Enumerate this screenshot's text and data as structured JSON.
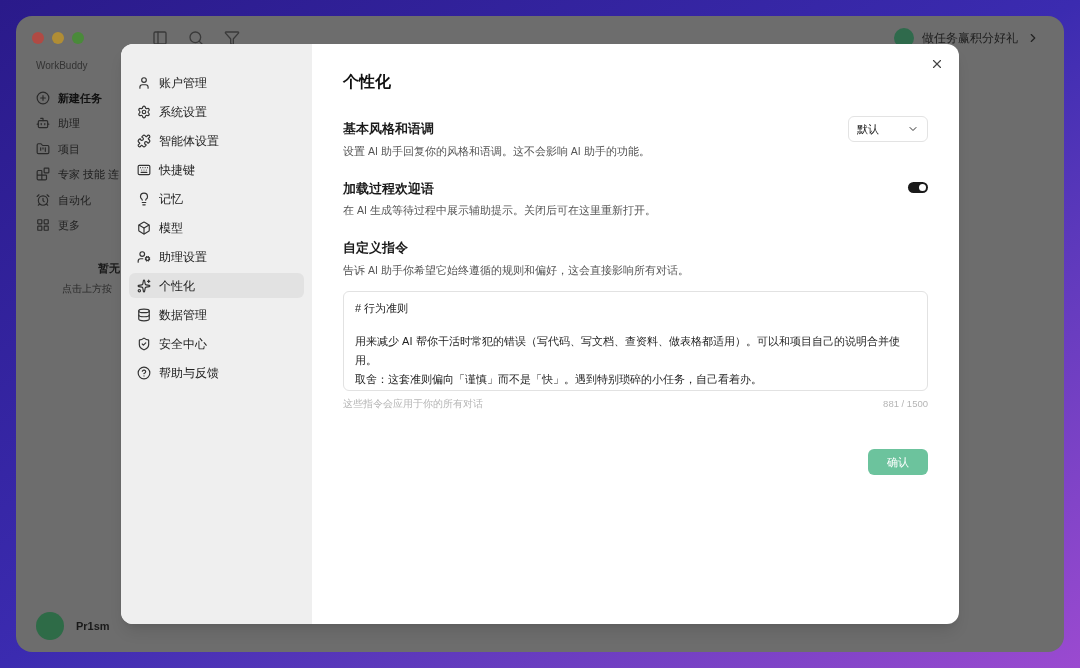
{
  "app": {
    "brand": "WorkBuddy",
    "promo": "做任务赢积分好礼",
    "nav": [
      {
        "label": "新建任务",
        "selected": true
      },
      {
        "label": "助理",
        "selected": false
      },
      {
        "label": "项目",
        "selected": false
      },
      {
        "label": "专家 技能 连",
        "selected": false
      },
      {
        "label": "自动化",
        "selected": false
      },
      {
        "label": "更多",
        "selected": false
      }
    ],
    "empty_title": "暂无",
    "empty_hint": "点击上方按",
    "user": "Pr1sm"
  },
  "settings": {
    "menu": [
      {
        "label": "账户管理",
        "selected": false
      },
      {
        "label": "系统设置",
        "selected": false
      },
      {
        "label": "智能体设置",
        "selected": false
      },
      {
        "label": "快捷键",
        "selected": false
      },
      {
        "label": "记忆",
        "selected": false
      },
      {
        "label": "模型",
        "selected": false
      },
      {
        "label": "助理设置",
        "selected": false
      },
      {
        "label": "个性化",
        "selected": true
      },
      {
        "label": "数据管理",
        "selected": false
      },
      {
        "label": "安全中心",
        "selected": false
      },
      {
        "label": "帮助与反馈",
        "selected": false
      }
    ],
    "title": "个性化",
    "style": {
      "label": "基本风格和语调",
      "description": "设置 AI 助手回复你的风格和语调。这不会影响 AI 助手的功能。",
      "value": "默认"
    },
    "greeting": {
      "label": "加载过程欢迎语",
      "description": "在 AI 生成等待过程中展示辅助提示。关闭后可在这里重新打开。",
      "on": true
    },
    "custom": {
      "label": "自定义指令",
      "description": "告诉 AI 助手你希望它始终遵循的规则和偏好，这会直接影响所有对话。",
      "lines": [
        "# 行为准则",
        "用来减少 AI 帮你干活时常犯的错误（写代码、写文档、查资料、做表格都适用）。可以和项目自己的说明合并使用。",
        "取舍：这套准则偏向「谨慎」而不是「快」。遇到特别琐碎的小任务，自己看着办。"
      ],
      "hint": "这些指令会应用于你的所有对话",
      "count": "881 / 1500"
    },
    "confirm": "确认"
  }
}
